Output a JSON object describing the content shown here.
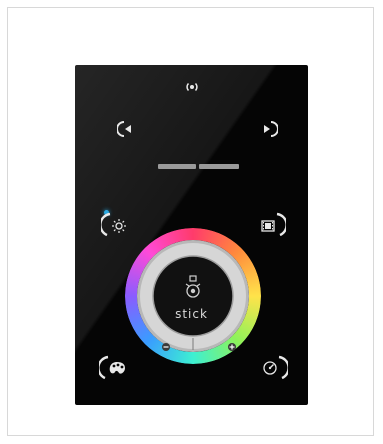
{
  "device": {
    "brand_label": "stick",
    "accent_led_color": "#2aa8e0",
    "panel_color": "#050505",
    "buttons": {
      "top": {
        "icon": "radio-waves-icon"
      },
      "left_arrow": {
        "icon": "arrow-left-icon"
      },
      "right_arrow": {
        "icon": "arrow-right-icon"
      },
      "brightness": {
        "icon": "sun-icon"
      },
      "scenes": {
        "icon": "film-icon"
      },
      "color_palette": {
        "icon": "palette-icon"
      },
      "speed": {
        "icon": "speedometer-icon"
      },
      "wheel_minus": {
        "icon": "minus-icon"
      },
      "wheel_plus": {
        "icon": "plus-icon"
      },
      "center": {
        "icon": "stick-logo-icon"
      }
    }
  }
}
